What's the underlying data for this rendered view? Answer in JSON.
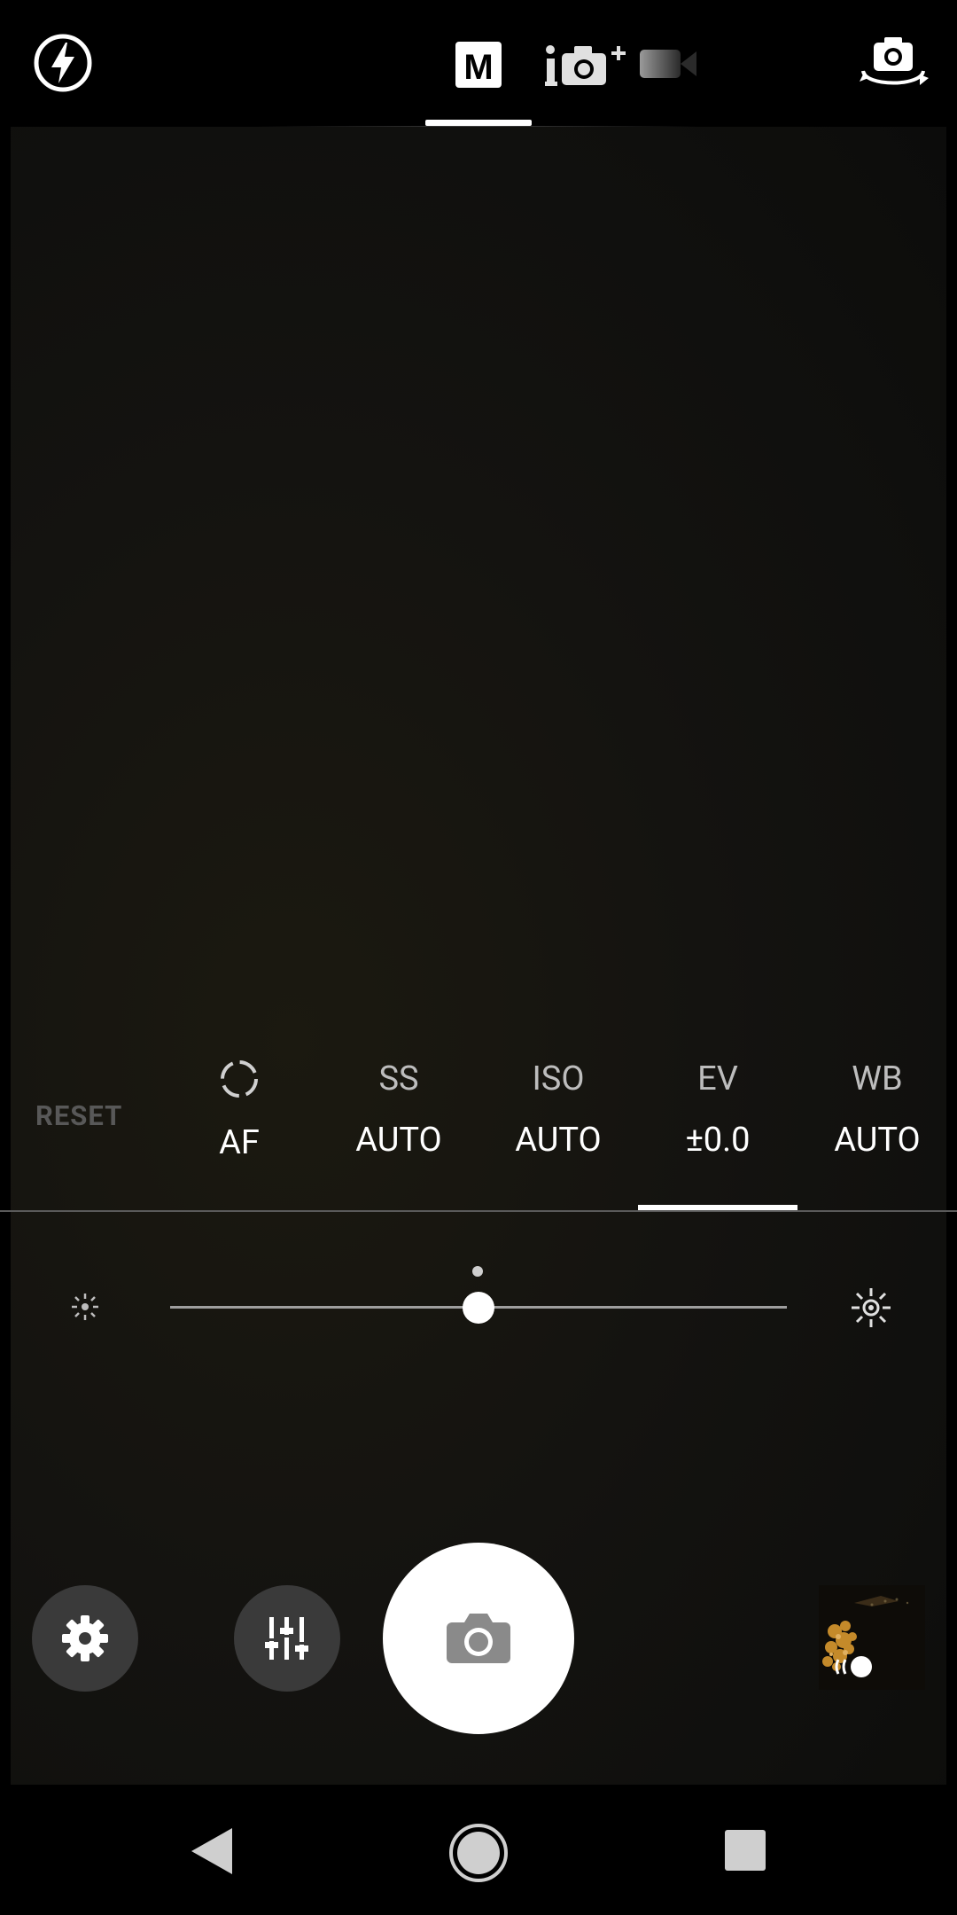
{
  "top_bar": {
    "flash_icon": "flash-auto-icon",
    "modes": [
      {
        "label": "M",
        "icon": "manual-mode-icon",
        "selected": true
      },
      {
        "icon": "intelligent-auto-plus-icon",
        "selected": false
      },
      {
        "icon": "video-camera-icon",
        "selected": false
      }
    ],
    "switch_camera_icon": "camera-switch-icon"
  },
  "manual_controls": {
    "reset_label": "RESET",
    "params": [
      {
        "key": "af",
        "label": "",
        "icon": "focus-ring-icon",
        "value": "AF",
        "selected": false
      },
      {
        "key": "ss",
        "label": "SS",
        "value": "AUTO",
        "selected": false
      },
      {
        "key": "iso",
        "label": "ISO",
        "value": "AUTO",
        "selected": false
      },
      {
        "key": "ev",
        "label": "EV",
        "value": "±0.0",
        "selected": true
      },
      {
        "key": "wb",
        "label": "WB",
        "value": "AUTO",
        "selected": false
      }
    ]
  },
  "ev_slider": {
    "value": 0.5,
    "min_icon": "brightness-low-icon",
    "max_icon": "brightness-high-icon"
  },
  "bottom_controls": {
    "settings_icon": "gear-icon",
    "adjust_icon": "sliders-icon",
    "shutter_icon": "camera-icon",
    "gallery_thumbnail": "last-photo-thumbnail"
  },
  "nav_bar": {
    "back_icon": "back-triangle-icon",
    "home_icon": "home-circle-icon",
    "recents_icon": "recents-square-icon"
  },
  "colors": {
    "background": "#000000",
    "viewfinder": "#141310",
    "accent": "#ffffff",
    "button_bg": "#3a3a3a",
    "inactive_label": "#bdbdbd",
    "reset_label": "#585858"
  }
}
